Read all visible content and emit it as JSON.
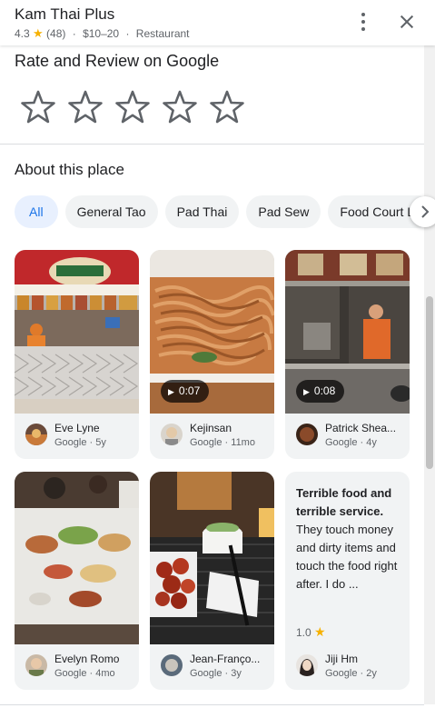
{
  "header": {
    "title": "Kam Thai Plus",
    "rating": "4.3",
    "star": "★",
    "review_count": "(48)",
    "price": "$10–20",
    "category": "Restaurant",
    "separator": "·"
  },
  "rate": {
    "title": "Rate and Review on Google",
    "stars": 5
  },
  "about": {
    "title": "About this place",
    "chips": [
      "All",
      "General Tao",
      "Pad Thai",
      "Pad Sew",
      "Food Court Lo"
    ],
    "selected_chip": "All"
  },
  "cards": [
    {
      "type": "photo",
      "subject": "food-court-counter",
      "author": "Eve Lyne",
      "source": "Google",
      "age": "5y"
    },
    {
      "type": "video",
      "subject": "noodles-container",
      "duration": "0:07",
      "author": "Kejinsan",
      "source": "Google",
      "age": "11mo"
    },
    {
      "type": "video",
      "subject": "kitchen-cook",
      "duration": "0:08",
      "author": "Patrick Shea...",
      "source": "Google",
      "age": "4y"
    },
    {
      "type": "photo",
      "subject": "dinner-table",
      "author": "Evelyn Romo",
      "source": "Google",
      "age": "4mo"
    },
    {
      "type": "photo",
      "subject": "general-tao-tray",
      "author": "Jean-Franço...",
      "source": "Google",
      "age": "3y"
    },
    {
      "type": "review",
      "review_bold": "Terrible food and terrible service.",
      "review_rest": " They touch money and dirty items and touch the food right after. I do ...",
      "rating": "1.0",
      "star": "★",
      "author": "Jiji Hm",
      "source": "Google",
      "age": "2y"
    }
  ],
  "colors": {
    "accent": "#1a73e8",
    "chip_active_bg": "#e8f0fe",
    "card_bg": "#f1f3f4",
    "star": "#f6b100"
  }
}
